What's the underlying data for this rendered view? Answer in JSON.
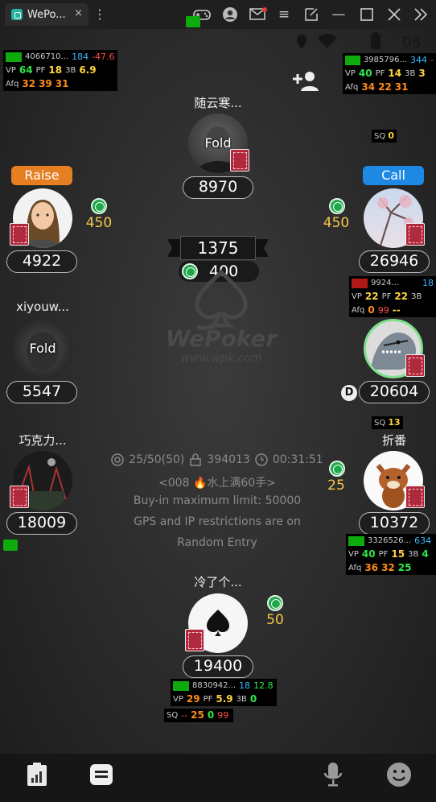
{
  "window": {
    "tab_title": "WePo...",
    "tab_close": "×"
  },
  "table": {
    "pot_main": "1375",
    "pot_bet": "400",
    "watermark_brand": "WePoker",
    "watermark_url": "www.wpk.com",
    "blinds": "25/50(50)",
    "club_id": "394013",
    "timer": "00:31:51",
    "club_name": "<008 🔥水上满60手>",
    "buyin_limit": "Buy-in maximum limit: 50000",
    "restrictions": "GPS and IP restrictions are on",
    "entry": "Random Entry",
    "dealer_label": "D"
  },
  "seats": [
    {
      "name": "随云寒...",
      "stack": "8970",
      "status": "Fold"
    },
    {
      "name": "",
      "stack": "4922",
      "action": "Raise",
      "bet": "450"
    },
    {
      "name": "",
      "stack": "26946",
      "action": "Call",
      "bet": "450"
    },
    {
      "name": "xiyouw...",
      "stack": "5547",
      "status": "Fold"
    },
    {
      "name": "",
      "stack": "20604"
    },
    {
      "name": "巧克力...",
      "stack": "18009"
    },
    {
      "name": "折番",
      "stack": "10372",
      "bet": "25"
    },
    {
      "name": "冷了个...",
      "stack": "19400",
      "bet": "50"
    }
  ],
  "huds": {
    "tl": {
      "id": "4066710...",
      "hands": "184",
      "profit": "-47.6",
      "vp": "64",
      "pf": "18",
      "tb": "6.9",
      "afq": [
        "32",
        "39",
        "31"
      ]
    },
    "tr": {
      "id": "3985796...",
      "hands": "344",
      "profit": "-",
      "vp": "40",
      "pf": "14",
      "tb": "3",
      "afq": [
        "34",
        "22",
        "31"
      ]
    },
    "r": {
      "id": "9924...",
      "hands": "18",
      "vp": "22",
      "pf": "22",
      "afq": [
        "0",
        "99",
        "--"
      ],
      "sq": "--"
    },
    "r2": {
      "id": "3326526...",
      "hands": "634",
      "vp": "40",
      "pf": "15",
      "tb": "4",
      "afq": [
        "36",
        "32",
        "25"
      ]
    },
    "hero": {
      "id": "8830942...",
      "hands": "18",
      "profit": "12.8",
      "vp": "29",
      "pf": "5.9",
      "tb": "0",
      "sq": [
        "--",
        "25",
        "0",
        "99"
      ]
    },
    "sq_top": "0",
    "sq_mid": "13"
  },
  "labels": {
    "vp": "VP",
    "pf": "PF",
    "tb": "3B",
    "afq": "Afq",
    "sq": "SQ"
  },
  "colors": {
    "raise": "#e67e22",
    "call": "#1e88e5",
    "chip": "#1fa84a",
    "bet": "#f5c94a",
    "hud_green": "#2ee64a",
    "hud_yellow": "#ffd33d"
  }
}
